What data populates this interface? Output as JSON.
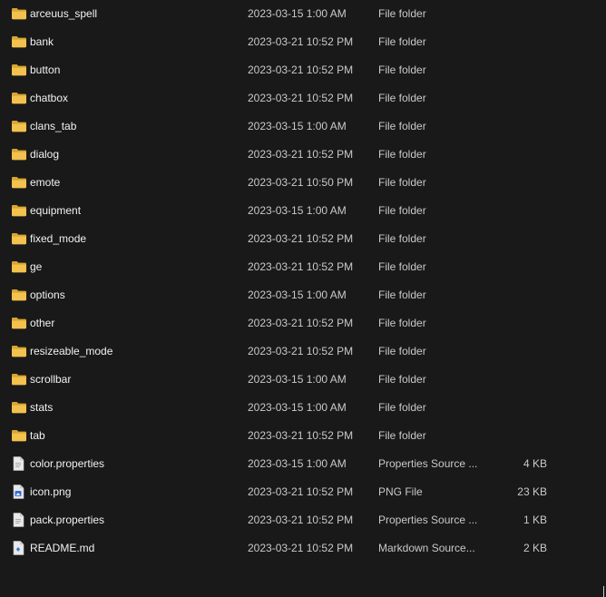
{
  "files": [
    {
      "name": "arceuus_spell",
      "modified": "2023-03-15 1:00 AM",
      "type": "File folder",
      "size": "",
      "icon": "folder-icon"
    },
    {
      "name": "bank",
      "modified": "2023-03-21 10:52 PM",
      "type": "File folder",
      "size": "",
      "icon": "folder-icon"
    },
    {
      "name": "button",
      "modified": "2023-03-21 10:52 PM",
      "type": "File folder",
      "size": "",
      "icon": "folder-icon"
    },
    {
      "name": "chatbox",
      "modified": "2023-03-21 10:52 PM",
      "type": "File folder",
      "size": "",
      "icon": "folder-icon"
    },
    {
      "name": "clans_tab",
      "modified": "2023-03-15 1:00 AM",
      "type": "File folder",
      "size": "",
      "icon": "folder-icon"
    },
    {
      "name": "dialog",
      "modified": "2023-03-21 10:52 PM",
      "type": "File folder",
      "size": "",
      "icon": "folder-icon"
    },
    {
      "name": "emote",
      "modified": "2023-03-21 10:50 PM",
      "type": "File folder",
      "size": "",
      "icon": "folder-icon"
    },
    {
      "name": "equipment",
      "modified": "2023-03-15 1:00 AM",
      "type": "File folder",
      "size": "",
      "icon": "folder-icon"
    },
    {
      "name": "fixed_mode",
      "modified": "2023-03-21 10:52 PM",
      "type": "File folder",
      "size": "",
      "icon": "folder-icon"
    },
    {
      "name": "ge",
      "modified": "2023-03-21 10:52 PM",
      "type": "File folder",
      "size": "",
      "icon": "folder-icon"
    },
    {
      "name": "options",
      "modified": "2023-03-15 1:00 AM",
      "type": "File folder",
      "size": "",
      "icon": "folder-icon"
    },
    {
      "name": "other",
      "modified": "2023-03-21 10:52 PM",
      "type": "File folder",
      "size": "",
      "icon": "folder-icon"
    },
    {
      "name": "resizeable_mode",
      "modified": "2023-03-21 10:52 PM",
      "type": "File folder",
      "size": "",
      "icon": "folder-icon"
    },
    {
      "name": "scrollbar",
      "modified": "2023-03-15 1:00 AM",
      "type": "File folder",
      "size": "",
      "icon": "folder-icon"
    },
    {
      "name": "stats",
      "modified": "2023-03-15 1:00 AM",
      "type": "File folder",
      "size": "",
      "icon": "folder-icon"
    },
    {
      "name": "tab",
      "modified": "2023-03-21 10:52 PM",
      "type": "File folder",
      "size": "",
      "icon": "folder-icon"
    },
    {
      "name": "color.properties",
      "modified": "2023-03-15 1:00 AM",
      "type": "Properties Source ...",
      "size": "4 KB",
      "icon": "document-icon"
    },
    {
      "name": "icon.png",
      "modified": "2023-03-21 10:52 PM",
      "type": "PNG File",
      "size": "23 KB",
      "icon": "image-file-icon"
    },
    {
      "name": "pack.properties",
      "modified": "2023-03-21 10:52 PM",
      "type": "Properties Source ...",
      "size": "1 KB",
      "icon": "document-icon"
    },
    {
      "name": "README.md",
      "modified": "2023-03-21 10:52 PM",
      "type": "Markdown Source...",
      "size": "2 KB",
      "icon": "markdown-file-icon"
    }
  ],
  "colors": {
    "background": "#191919",
    "folder": "#f2c14e",
    "folder_dark": "#d9a532",
    "document": "#e9e9e9",
    "image_accent": "#2f6fd6",
    "markdown_accent": "#3b7bd9"
  }
}
